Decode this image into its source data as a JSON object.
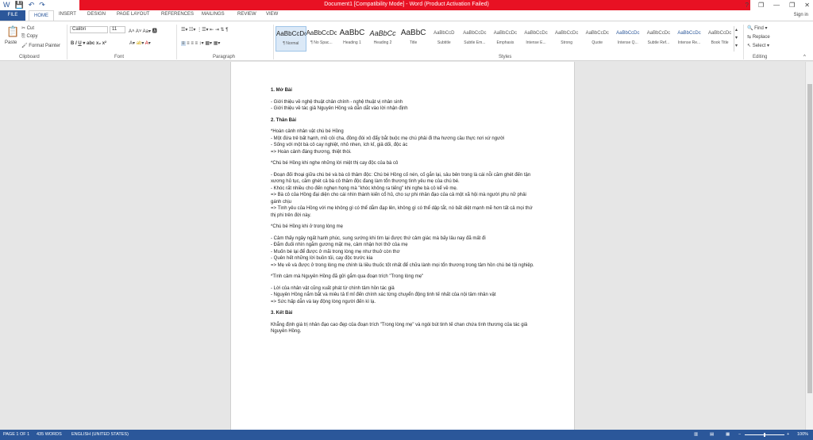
{
  "titlebar": {
    "title": "Document1 [Compatibility Mode] - Word (Product Activation Failed)",
    "controls": [
      "?",
      "❐",
      "—",
      "❐",
      "✕"
    ]
  },
  "qat": [
    "W",
    "💾",
    "↶",
    "↷"
  ],
  "tabs": {
    "file": "FILE",
    "items": [
      "HOME",
      "INSERT",
      "DESIGN",
      "PAGE LAYOUT",
      "REFERENCES",
      "MAILINGS",
      "REVIEW",
      "VIEW"
    ],
    "signin": "Sign in"
  },
  "ribbon": {
    "clipboard": {
      "paste": "Paste",
      "cut": "Cut",
      "copy": "Copy",
      "format_painter": "Format Painter",
      "label": "Clipboard"
    },
    "font": {
      "name": "Calibri",
      "size": "11",
      "label": "Font"
    },
    "paragraph": {
      "label": "Paragraph"
    },
    "styles": {
      "label": "Styles",
      "items": [
        {
          "preview": "AaBbCcDc",
          "name": "¶ Normal"
        },
        {
          "preview": "AaBbCcDc",
          "name": "¶ No Spac..."
        },
        {
          "preview": "AaBbC",
          "name": "Heading 1"
        },
        {
          "preview": "AaBbCc",
          "name": "Heading 2"
        },
        {
          "preview": "AaBbC",
          "name": "Title"
        },
        {
          "preview": "AaBbCcD",
          "name": "Subtitle"
        },
        {
          "preview": "AaBbCcDc",
          "name": "Subtle Em..."
        },
        {
          "preview": "AaBbCcDc",
          "name": "Emphasis"
        },
        {
          "preview": "AaBbCcDc",
          "name": "Intense E..."
        },
        {
          "preview": "AaBbCcDc",
          "name": "Strong"
        },
        {
          "preview": "AaBbCcDc",
          "name": "Quote"
        },
        {
          "preview": "AaBbCcDc",
          "name": "Intense Q..."
        },
        {
          "preview": "AaBbCcDc",
          "name": "Subtle Ref..."
        },
        {
          "preview": "AaBbCcDc",
          "name": "Intense Re..."
        },
        {
          "preview": "AaBbCcDc",
          "name": "Book Title"
        }
      ]
    },
    "editing": {
      "find": "Find",
      "replace": "Replace",
      "select": "Select",
      "label": "Editing"
    }
  },
  "document": {
    "lines": [
      {
        "type": "h",
        "text": "1. Mở Bài"
      },
      {
        "type": "p",
        "text": "- Giới thiệu về nghệ thuật chân chính - nghệ thuật vị nhân sinh"
      },
      {
        "type": "p",
        "text": "- Giới thiệu về tác giả Nguyên Hồng và dẫn dắt vào lời nhận định"
      },
      {
        "type": "h",
        "text": "2. Thân Bài"
      },
      {
        "type": "p",
        "text": "*Hoàn cảnh nhân vật chú bé Hồng"
      },
      {
        "type": "p",
        "text": "- Một đứa trẻ bất hạnh, mồ côi cha, đồng đói xô đẩy bắt buộc mẹ chú phải đi tha hương cầu thực nơi xứ người"
      },
      {
        "type": "p",
        "text": "- Sống với một bà cô cay nghiệt, nhỏ nhen, ích kỉ, giả dối, độc ác"
      },
      {
        "type": "p",
        "text": "=> Hoàn cảnh đáng thương, thiệt thòi."
      },
      {
        "type": "g",
        "text": "*Chú bé Hồng khi nghe những lời miệt thị cay độc của bà cô"
      },
      {
        "type": "g",
        "text": "- Đoạn đối thoại giữa chú bé và bà cô thâm độc: Chú bé Hồng cố nén, cố gắn lại, sâu bên trong là cái nỗi căm ghét đến tận xương hủ tục, căm ghét cả bà cô thâm độc đang làm tổn thương tình yêu mẹ của chú bé."
      },
      {
        "type": "p",
        "text": "- Khóc rất nhiều cho đến nghẹn họng mà \"khóc không ra tiếng\" khi nghe bà cô kể về mẹ."
      },
      {
        "type": "p",
        "text": "=> Bà cô của Hồng đại diện cho cái nhìn thành kiến cổ hủ, cho sự phi nhân đạo của cả một xã hội mà người phụ nữ phải gánh chịu"
      },
      {
        "type": "p",
        "text": "=> Tình yêu của Hồng với mẹ không gì có thể dằm đạp lên, không gì có thể dập tắt, nó bất diệt mạnh mẽ hơn tất cả mọi thứ thị phi trên đời này."
      },
      {
        "type": "g",
        "text": "*Chú bé Hồng khi ở trong lòng mẹ"
      },
      {
        "type": "g",
        "text": "- Cảm thấy ngây ngất hạnh phúc, sung sướng khi tìm lại được thứ cảm giác mà bấy lâu nay đã mất đi"
      },
      {
        "type": "p",
        "text": "- Đắm đuối nhìn ngắm gương mặt mẹ, cảm nhận hơi thở của mẹ"
      },
      {
        "type": "p",
        "text": "- Muốn bé lại để được ở mãi trong lòng mẹ như thuở còn thơ"
      },
      {
        "type": "p",
        "text": "- Quên hết những lời buồn tủi, cay độc trước kia"
      },
      {
        "type": "p",
        "text": "=> Mẹ về và được ở trong lòng mẹ chính là liều thuốc tốt nhất để chữa lành mọi tổn thương trong tâm hồn chú bé tội nghiệp."
      },
      {
        "type": "g",
        "text": "*Tình cảm mà Nguyên Hồng đã gửi gắm qua đoạn trích \"Trong lòng mẹ\""
      },
      {
        "type": "g",
        "text": "- Lời của nhân vật cũng xuất phát từ chính tâm hồn tác giả"
      },
      {
        "type": "p",
        "text": "- Nguyên Hồng nắm bắt và miêu tả tỉ mỉ đến chính xác từng chuyển động tinh tế nhất của nội tâm nhân vật"
      },
      {
        "type": "p",
        "text": "=> Sức hấp dẫn và lay động lòng người đến kì lạ."
      },
      {
        "type": "h",
        "text": "3. Kết Bài"
      },
      {
        "type": "p",
        "text": "Khẳng định giá trị nhân đạo cao đẹp của đoạn trích \"Trong lòng mẹ\" và ngòi bút tinh tế chan chứa tình thương của tác giả Nguyên Hồng."
      }
    ]
  },
  "statusbar": {
    "page": "PAGE 1 OF 1",
    "words": "435 WORDS",
    "language": "ENGLISH (UNITED STATES)",
    "zoom": "100%"
  },
  "colors": {
    "accent": "#2b579a",
    "titlebar": "#e81123"
  }
}
